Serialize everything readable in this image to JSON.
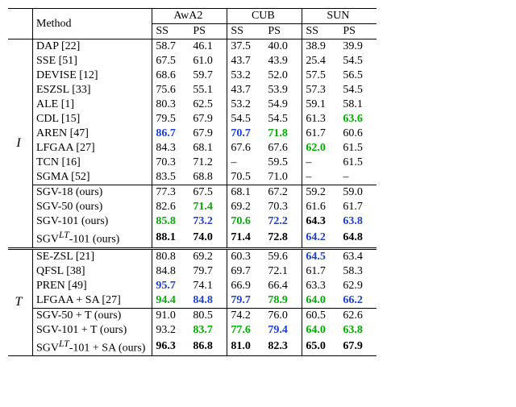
{
  "header": {
    "method": "Method",
    "datasets": [
      "AwA2",
      "CUB",
      "SUN"
    ],
    "splits": [
      "SS",
      "PS"
    ]
  },
  "groups": [
    {
      "label": "I",
      "sections": [
        {
          "rows": [
            {
              "method": "DAP [22]",
              "vals": [
                {
                  "t": "58.7"
                },
                {
                  "t": "46.1"
                },
                {
                  "t": "37.5"
                },
                {
                  "t": "40.0"
                },
                {
                  "t": "38.9"
                },
                {
                  "t": "39.9"
                }
              ]
            },
            {
              "method": "SSE [51]",
              "vals": [
                {
                  "t": "67.5"
                },
                {
                  "t": "61.0"
                },
                {
                  "t": "43.7"
                },
                {
                  "t": "43.9"
                },
                {
                  "t": "25.4"
                },
                {
                  "t": "54.5"
                }
              ]
            },
            {
              "method": "DEVISE [12]",
              "vals": [
                {
                  "t": "68.6"
                },
                {
                  "t": "59.7"
                },
                {
                  "t": "53.2"
                },
                {
                  "t": "52.0"
                },
                {
                  "t": "57.5"
                },
                {
                  "t": "56.5"
                }
              ]
            },
            {
              "method": "ESZSL [33]",
              "vals": [
                {
                  "t": "75.6"
                },
                {
                  "t": "55.1"
                },
                {
                  "t": "43.7"
                },
                {
                  "t": "53.9"
                },
                {
                  "t": "57.3"
                },
                {
                  "t": "54.5"
                }
              ]
            },
            {
              "method": "ALE [1]",
              "vals": [
                {
                  "t": "80.3"
                },
                {
                  "t": "62.5"
                },
                {
                  "t": "53.2"
                },
                {
                  "t": "54.9"
                },
                {
                  "t": "59.1"
                },
                {
                  "t": "58.1"
                }
              ]
            },
            {
              "method": "CDL [15]",
              "vals": [
                {
                  "t": "79.5"
                },
                {
                  "t": "67.9"
                },
                {
                  "t": "54.5"
                },
                {
                  "t": "54.5"
                },
                {
                  "t": "61.3"
                },
                {
                  "t": "63.6",
                  "c": "green"
                }
              ]
            },
            {
              "method": "AREN [47]",
              "vals": [
                {
                  "t": "86.7",
                  "c": "blue"
                },
                {
                  "t": "67.9"
                },
                {
                  "t": "70.7",
                  "c": "blue"
                },
                {
                  "t": "71.8",
                  "c": "green"
                },
                {
                  "t": "61.7"
                },
                {
                  "t": "60.6"
                }
              ]
            },
            {
              "method": "LFGAA [27]",
              "vals": [
                {
                  "t": "84.3"
                },
                {
                  "t": "68.1"
                },
                {
                  "t": "67.6"
                },
                {
                  "t": "67.6"
                },
                {
                  "t": "62.0",
                  "c": "green"
                },
                {
                  "t": "61.5"
                }
              ]
            },
            {
              "method": "TCN [16]",
              "vals": [
                {
                  "t": "70.3"
                },
                {
                  "t": "71.2"
                },
                {
                  "t": "–"
                },
                {
                  "t": "59.5"
                },
                {
                  "t": "–"
                },
                {
                  "t": "61.5"
                }
              ]
            },
            {
              "method": "SGMA [52]",
              "vals": [
                {
                  "t": "83.5"
                },
                {
                  "t": "68.8"
                },
                {
                  "t": "70.5"
                },
                {
                  "t": "71.0"
                },
                {
                  "t": "–"
                },
                {
                  "t": "–"
                }
              ]
            }
          ]
        },
        {
          "rows": [
            {
              "method": "SGV-18 (ours)",
              "vals": [
                {
                  "t": "77.3"
                },
                {
                  "t": "67.5"
                },
                {
                  "t": "68.1"
                },
                {
                  "t": "67.2"
                },
                {
                  "t": "59.2"
                },
                {
                  "t": "59.0"
                }
              ]
            },
            {
              "method": "SGV-50 (ours)",
              "vals": [
                {
                  "t": "82.6"
                },
                {
                  "t": "71.4",
                  "c": "green"
                },
                {
                  "t": "69.2"
                },
                {
                  "t": "70.3"
                },
                {
                  "t": "61.6"
                },
                {
                  "t": "61.7"
                }
              ]
            },
            {
              "method": "SGV-101 (ours)",
              "vals": [
                {
                  "t": "85.8",
                  "c": "green"
                },
                {
                  "t": "73.2",
                  "c": "blue"
                },
                {
                  "t": "70.6",
                  "c": "green"
                },
                {
                  "t": "72.2",
                  "c": "blue"
                },
                {
                  "t": "64.3",
                  "c": "bold"
                },
                {
                  "t": "63.8",
                  "c": "blue"
                }
              ]
            },
            {
              "method_html": "SGV<sup><i>LT</i></sup>-101 (ours)",
              "vals": [
                {
                  "t": "88.1",
                  "c": "bold"
                },
                {
                  "t": "74.0",
                  "c": "bold"
                },
                {
                  "t": "71.4",
                  "c": "bold"
                },
                {
                  "t": "72.8",
                  "c": "bold"
                },
                {
                  "t": "64.2",
                  "c": "blue"
                },
                {
                  "t": "64.8",
                  "c": "bold"
                }
              ]
            }
          ]
        }
      ]
    },
    {
      "label": "T",
      "sections": [
        {
          "rows": [
            {
              "method": "SE-ZSL [21]",
              "vals": [
                {
                  "t": "80.8"
                },
                {
                  "t": "69.2"
                },
                {
                  "t": "60.3"
                },
                {
                  "t": "59.6"
                },
                {
                  "t": "64.5",
                  "c": "blue"
                },
                {
                  "t": "63.4"
                }
              ]
            },
            {
              "method": "QFSL [38]",
              "vals": [
                {
                  "t": "84.8"
                },
                {
                  "t": "79.7"
                },
                {
                  "t": "69.7"
                },
                {
                  "t": "72.1"
                },
                {
                  "t": "61.7"
                },
                {
                  "t": "58.3"
                }
              ]
            },
            {
              "method": "PREN [49]",
              "vals": [
                {
                  "t": "95.7",
                  "c": "blue"
                },
                {
                  "t": "74.1"
                },
                {
                  "t": "66.9"
                },
                {
                  "t": "66.4"
                },
                {
                  "t": "63.3"
                },
                {
                  "t": "62.9"
                }
              ]
            },
            {
              "method": "LFGAA + SA [27]",
              "vals": [
                {
                  "t": "94.4",
                  "c": "green"
                },
                {
                  "t": "84.8",
                  "c": "blue"
                },
                {
                  "t": "79.7",
                  "c": "blue"
                },
                {
                  "t": "78.9",
                  "c": "green"
                },
                {
                  "t": "64.0",
                  "c": "green"
                },
                {
                  "t": "66.2",
                  "c": "blue"
                }
              ]
            }
          ]
        },
        {
          "rows": [
            {
              "method": "SGV-50 + T (ours)",
              "vals": [
                {
                  "t": "91.0"
                },
                {
                  "t": "80.5"
                },
                {
                  "t": "74.2"
                },
                {
                  "t": "76.0"
                },
                {
                  "t": "60.5"
                },
                {
                  "t": "62.6"
                }
              ]
            },
            {
              "method": "SGV-101 + T (ours)",
              "vals": [
                {
                  "t": "93.2"
                },
                {
                  "t": "83.7",
                  "c": "green"
                },
                {
                  "t": "77.6",
                  "c": "green"
                },
                {
                  "t": "79.4",
                  "c": "blue"
                },
                {
                  "t": "64.0",
                  "c": "green"
                },
                {
                  "t": "63.8",
                  "c": "green"
                }
              ]
            },
            {
              "method_html": "SGV<sup><i>LT</i></sup>-101 + SA (ours)",
              "vals": [
                {
                  "t": "96.3",
                  "c": "bold"
                },
                {
                  "t": "86.8",
                  "c": "bold"
                },
                {
                  "t": "81.0",
                  "c": "bold"
                },
                {
                  "t": "82.3",
                  "c": "bold"
                },
                {
                  "t": "65.0",
                  "c": "bold"
                },
                {
                  "t": "67.9",
                  "c": "bold"
                }
              ]
            }
          ]
        }
      ]
    }
  ]
}
